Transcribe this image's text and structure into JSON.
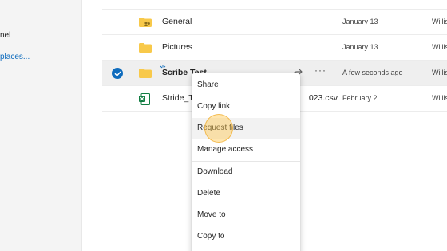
{
  "sidebar": {
    "items": [
      {
        "label": "nel"
      },
      {
        "label": "places..."
      }
    ]
  },
  "files": [
    {
      "name": "General",
      "icon": "folder-shared-icon",
      "modified": "January 13",
      "modified_by": "Willis",
      "selected": false
    },
    {
      "name": "Pictures",
      "icon": "folder-icon",
      "modified": "January 13",
      "modified_by": "Willis",
      "selected": false
    },
    {
      "name": "Scribe Test",
      "icon": "folder-icon",
      "modified": "A few seconds ago",
      "modified_by": "Willis",
      "selected": true
    },
    {
      "name": "Stride_T",
      "name_suffix": "023.csv",
      "icon": "excel-file-icon",
      "modified": "February 2",
      "modified_by": "Willis",
      "selected": false
    }
  ],
  "row_actions": {
    "more": "···"
  },
  "context_menu": {
    "items": [
      "Share",
      "Copy link",
      "Request files",
      "Manage access",
      "Download",
      "Delete",
      "Move to",
      "Copy to"
    ],
    "hovered": "Request files"
  },
  "colors": {
    "accent": "#0f6cbd",
    "folder": "#f8c94a",
    "excel": "#107c41"
  }
}
